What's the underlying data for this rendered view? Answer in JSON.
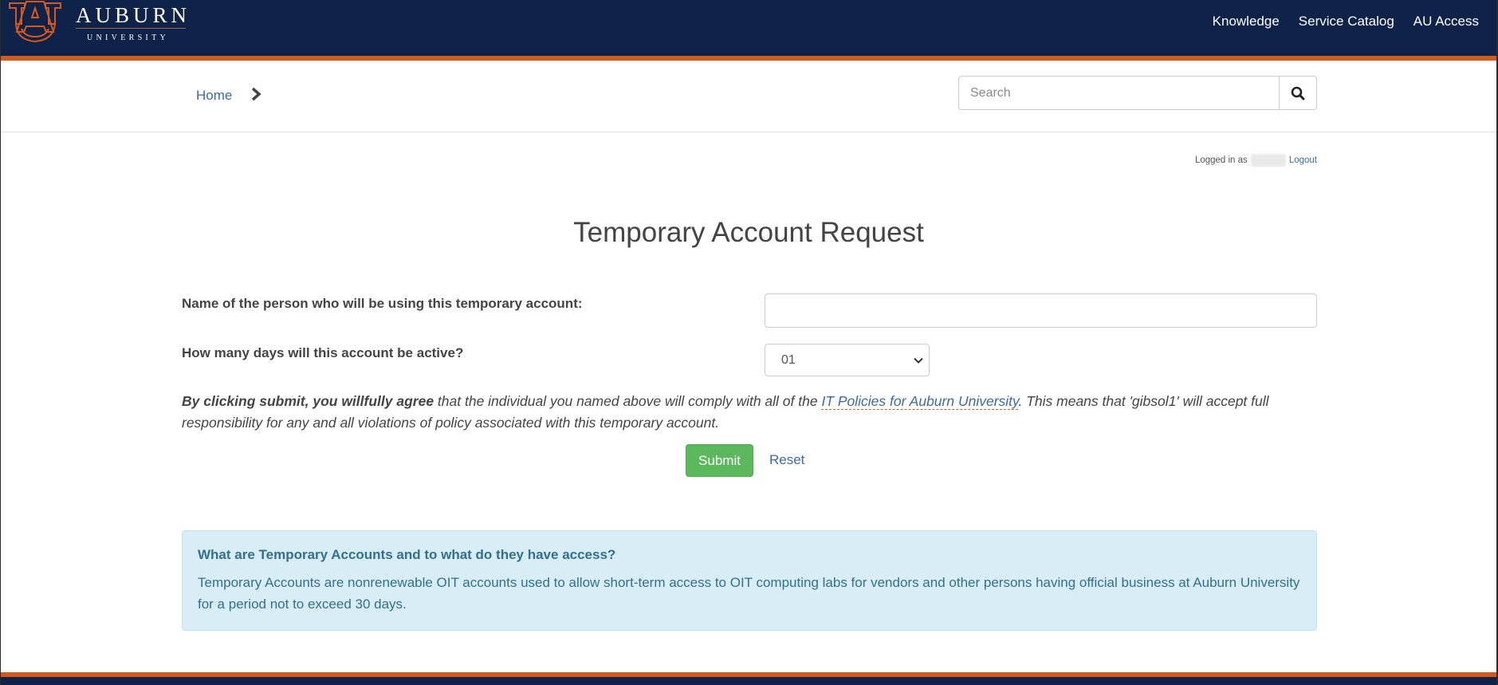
{
  "header": {
    "logo": {
      "word": "AUBURN",
      "sub": "UNIVERSITY",
      "colors": {
        "navy": "#0f2249",
        "orange": "#d4591d"
      }
    },
    "nav": [
      {
        "label": "Knowledge"
      },
      {
        "label": "Service Catalog"
      },
      {
        "label": "AU Access"
      }
    ]
  },
  "breadcrumb": {
    "home": "Home",
    "separator_icon": "chevron-right-icon"
  },
  "search": {
    "placeholder": "Search",
    "button_icon": "search-icon"
  },
  "session": {
    "logged_in_prefix": "Logged in as",
    "username": "",
    "logout": "Logout"
  },
  "form": {
    "title": "Temporary Account Request",
    "name_label": "Name of the person who will be using this temporary account:",
    "name_value": "",
    "days_label": "How many days will this account be active?",
    "days_selected": "01",
    "disclaimer": {
      "bold": "By clicking submit, you willfully agree",
      "part1": " that the individual you named above will comply with all of the ",
      "link": "IT Policies for Auburn University",
      "part2": ". This means that 'gibsol1' will accept full responsibility for any and all violations of policy associated with this temporary account."
    },
    "submit": "Submit",
    "reset": "Reset"
  },
  "info": {
    "heading": "What are Temporary Accounts and to what do they have access?",
    "body": "Temporary Accounts are nonrenewable OIT accounts used to allow short-term access to OIT computing labs for vendors and other persons having official business at Auburn University for a period not to exceed 30 days."
  }
}
